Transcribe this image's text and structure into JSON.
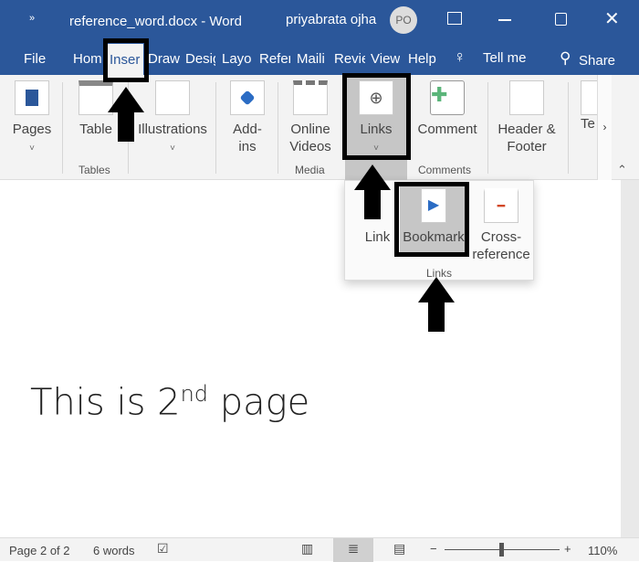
{
  "titlebar": {
    "quick_access": "»",
    "doc_title": "reference_word.docx  -  Word",
    "user": "priyabrata ojha",
    "avatar": "PO"
  },
  "tabs": [
    {
      "label": "File"
    },
    {
      "label": "Hom"
    },
    {
      "label": "Inser"
    },
    {
      "label": "Draw"
    },
    {
      "label": "Desig"
    },
    {
      "label": "Layo"
    },
    {
      "label": "Refer"
    },
    {
      "label": "Maili"
    },
    {
      "label": "Revie"
    },
    {
      "label": "View"
    },
    {
      "label": "Help"
    }
  ],
  "tell_me": "Tell me",
  "share": "Share",
  "ribbon": {
    "pages": "Pages",
    "table": "Table",
    "illustrations": "Illustrations",
    "addins": "Add-ins",
    "online_videos": "Online Videos",
    "links": "Links",
    "comment": "Comment",
    "header_footer": "Header & Footer",
    "te": "Te",
    "chev": "˅",
    "groups": {
      "tables": "Tables",
      "media": "Media",
      "comments": "Comments"
    }
  },
  "popup": {
    "link": "Link",
    "bookmark": "Bookmark",
    "cross_reference": "Cross-reference",
    "group": "Links"
  },
  "document": {
    "text": "This is 2",
    "sup": "nd",
    "text_after": " page"
  },
  "status": {
    "page": "Page 2 of 2",
    "words": "6 words",
    "zoom": "110%",
    "zoom_level_percent": 110
  },
  "colors": {
    "accent": "#2b579a",
    "highlight": "#c6c6c6"
  }
}
